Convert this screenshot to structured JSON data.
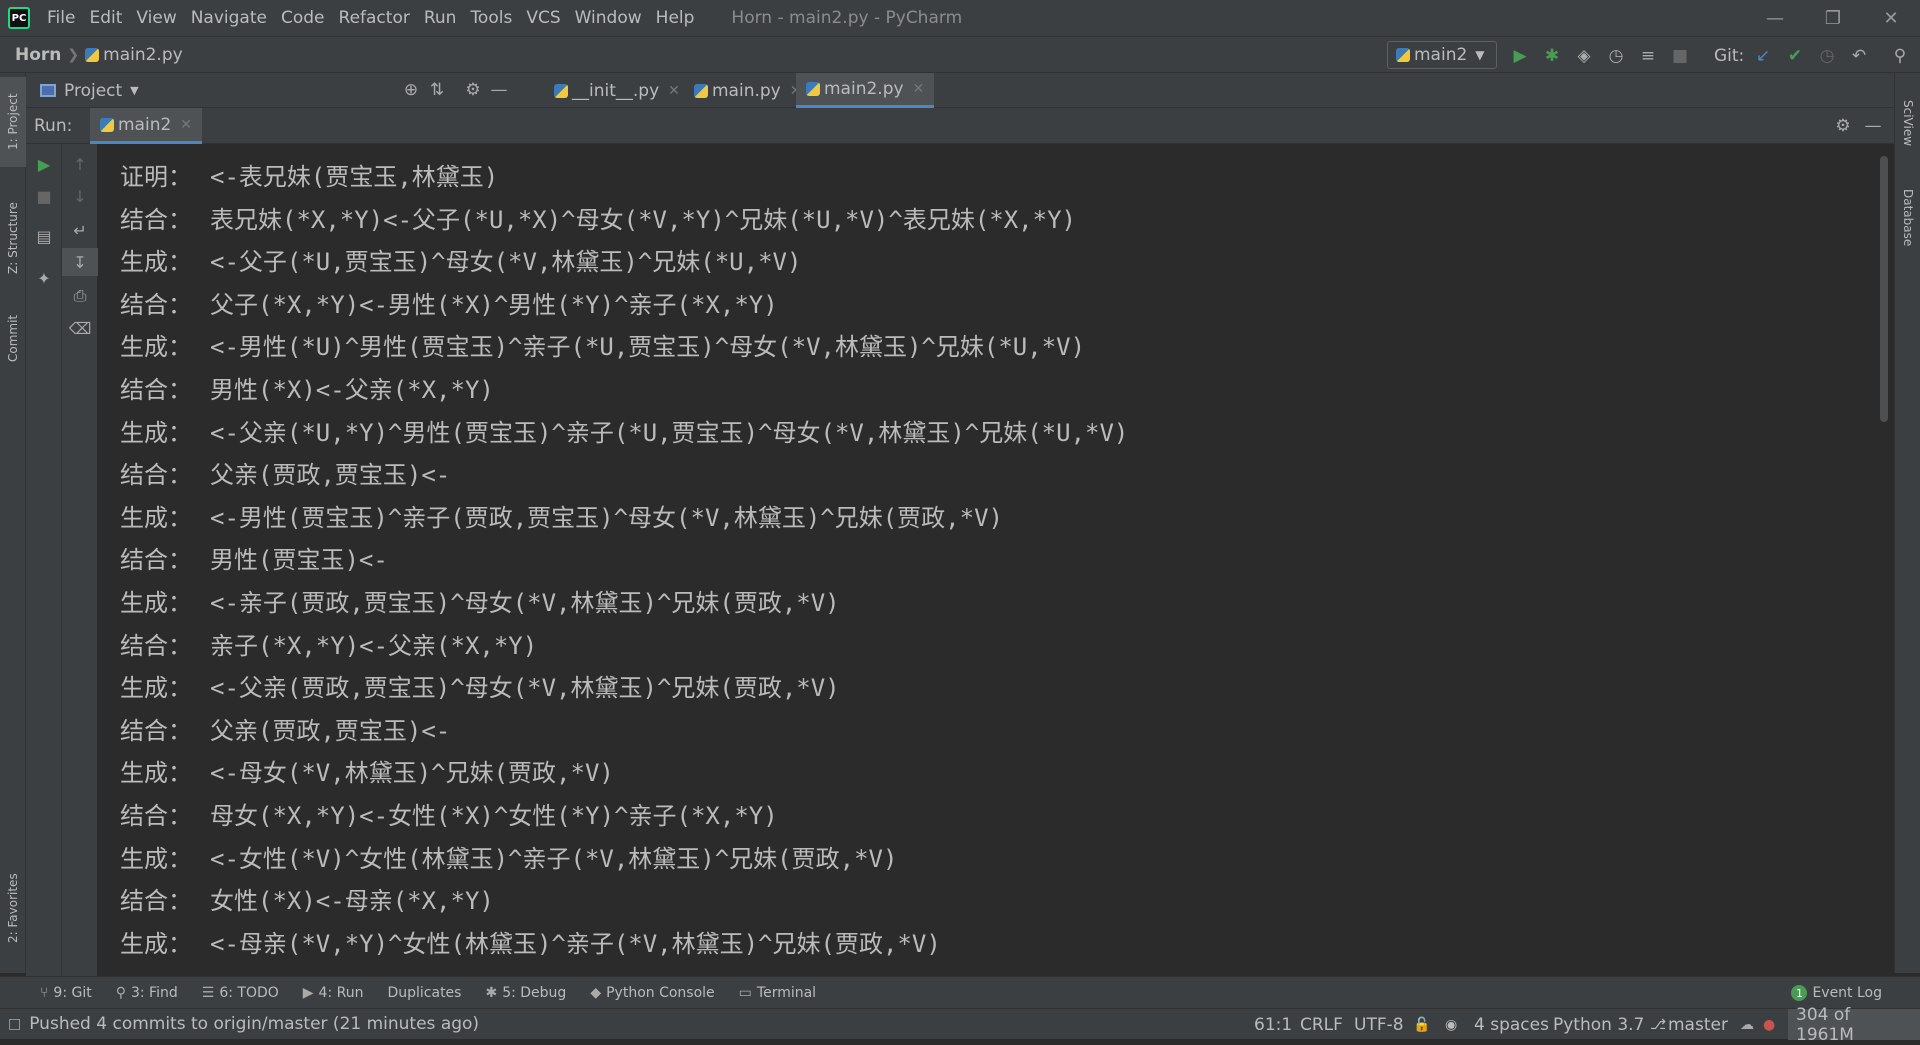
{
  "titlebar": {
    "menu": [
      "File",
      "Edit",
      "View",
      "Navigate",
      "Code",
      "Refactor",
      "Run",
      "Tools",
      "VCS",
      "Window",
      "Help"
    ],
    "window_title": "Horn - main2.py - PyCharm",
    "logo_text": "PC"
  },
  "navbar": {
    "project": "Horn",
    "file": "main2.py",
    "run_config": "main2",
    "git_label": "Git:"
  },
  "left_strip": {
    "project": "1: Project",
    "structure": "Z: Structure",
    "commit": "Commit",
    "favorites": "2: Favorites"
  },
  "right_strip": {
    "sciview": "SciView",
    "database": "Database"
  },
  "project_tool": {
    "label": "Project"
  },
  "editor_tabs": [
    {
      "label": "__init__.py"
    },
    {
      "label": "main.py"
    },
    {
      "label": "main2.py"
    }
  ],
  "run_panel": {
    "label": "Run:",
    "tab": "main2"
  },
  "console": {
    "lines": [
      {
        "kind": "证明：",
        "text": "<-表兄妹(贾宝玉,林黛玉)"
      },
      {
        "kind": "结合：",
        "text": "表兄妹(*X,*Y)<-父子(*U,*X)^母女(*V,*Y)^兄妹(*U,*V)^表兄妹(*X,*Y)"
      },
      {
        "kind": "生成：",
        "text": "<-父子(*U,贾宝玉)^母女(*V,林黛玉)^兄妹(*U,*V)"
      },
      {
        "kind": "结合：",
        "text": "父子(*X,*Y)<-男性(*X)^男性(*Y)^亲子(*X,*Y)"
      },
      {
        "kind": "生成：",
        "text": "<-男性(*U)^男性(贾宝玉)^亲子(*U,贾宝玉)^母女(*V,林黛玉)^兄妹(*U,*V)"
      },
      {
        "kind": "结合：",
        "text": "男性(*X)<-父亲(*X,*Y)"
      },
      {
        "kind": "生成：",
        "text": "<-父亲(*U,*Y)^男性(贾宝玉)^亲子(*U,贾宝玉)^母女(*V,林黛玉)^兄妹(*U,*V)"
      },
      {
        "kind": "结合：",
        "text": "父亲(贾政,贾宝玉)<-"
      },
      {
        "kind": "生成：",
        "text": "<-男性(贾宝玉)^亲子(贾政,贾宝玉)^母女(*V,林黛玉)^兄妹(贾政,*V)"
      },
      {
        "kind": "结合：",
        "text": "男性(贾宝玉)<-"
      },
      {
        "kind": "生成：",
        "text": "<-亲子(贾政,贾宝玉)^母女(*V,林黛玉)^兄妹(贾政,*V)"
      },
      {
        "kind": "结合：",
        "text": "亲子(*X,*Y)<-父亲(*X,*Y)"
      },
      {
        "kind": "生成：",
        "text": "<-父亲(贾政,贾宝玉)^母女(*V,林黛玉)^兄妹(贾政,*V)"
      },
      {
        "kind": "结合：",
        "text": "父亲(贾政,贾宝玉)<-"
      },
      {
        "kind": "生成：",
        "text": "<-母女(*V,林黛玉)^兄妹(贾政,*V)"
      },
      {
        "kind": "结合：",
        "text": "母女(*X,*Y)<-女性(*X)^女性(*Y)^亲子(*X,*Y)"
      },
      {
        "kind": "生成：",
        "text": "<-女性(*V)^女性(林黛玉)^亲子(*V,林黛玉)^兄妹(贾政,*V)"
      },
      {
        "kind": "结合：",
        "text": "女性(*X)<-母亲(*X,*Y)"
      },
      {
        "kind": "生成：",
        "text": "<-母亲(*V,*Y)^女性(林黛玉)^亲子(*V,林黛玉)^兄妹(贾政,*V)"
      }
    ]
  },
  "bottom_tabs": [
    {
      "icon": "git-branch-icon",
      "glyph": "⑂",
      "label": "9: Git"
    },
    {
      "icon": "search-icon",
      "glyph": "⚲",
      "label": "3: Find"
    },
    {
      "icon": "todo-list-icon",
      "glyph": "☰",
      "label": "6: TODO"
    },
    {
      "icon": "run-icon",
      "glyph": "▶",
      "label": "4: Run"
    },
    {
      "icon": "",
      "glyph": "",
      "label": "Duplicates"
    },
    {
      "icon": "bug-icon",
      "glyph": "✱",
      "label": "5: Debug"
    },
    {
      "icon": "python-icon",
      "glyph": "◆",
      "label": "Python Console"
    },
    {
      "icon": "terminal-icon",
      "glyph": "▭",
      "label": "Terminal"
    }
  ],
  "event_log": {
    "label": "Event Log",
    "count": "1"
  },
  "statusbar": {
    "message": "Pushed 4 commits to origin/master (21 minutes ago)",
    "position": "61:1",
    "line_sep": "CRLF",
    "encoding": "UTF-8",
    "indent": "4 spaces",
    "interpreter": "Python 3.7",
    "branch": "master",
    "memory": "304 of 1961M"
  },
  "colors": {
    "background": "#2b2b2b",
    "panel": "#3c3f41",
    "run_green": "#499c54",
    "accent_blue": "#4a88c7",
    "error_red": "#c75450"
  }
}
